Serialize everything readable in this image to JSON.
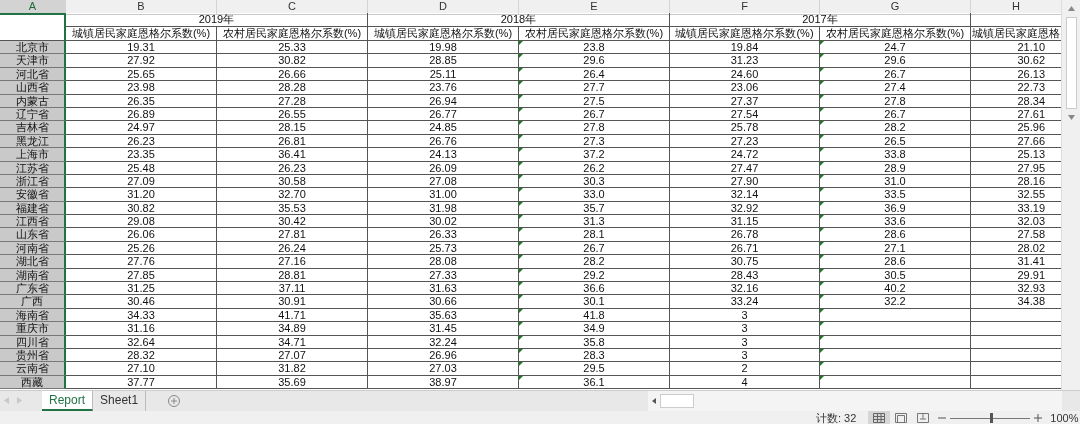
{
  "column_letters": [
    {
      "label": "A",
      "selected": true
    },
    {
      "label": "B",
      "selected": false
    },
    {
      "label": "C",
      "selected": false
    },
    {
      "label": "D",
      "selected": false
    },
    {
      "label": "E",
      "selected": false
    },
    {
      "label": "F",
      "selected": false
    },
    {
      "label": "G",
      "selected": false
    },
    {
      "label": "H",
      "selected": false
    }
  ],
  "year_groups": [
    {
      "label": "2019年"
    },
    {
      "label": "2018年"
    },
    {
      "label": "2017年"
    }
  ],
  "columns": [
    {
      "header": "城镇居民家庭恩格尔系数(%)",
      "flagged": false
    },
    {
      "header": "农村居民家庭恩格尔系数(%)",
      "flagged": false
    },
    {
      "header": "城镇居民家庭恩格尔系数(%)",
      "flagged": false
    },
    {
      "header": "农村居民家庭恩格尔系数(%)",
      "flagged": true
    },
    {
      "header": "城镇居民家庭恩格尔系数(%)",
      "flagged": false
    },
    {
      "header": "农村居民家庭恩格尔系数(%)",
      "flagged": true
    },
    {
      "header": "城镇居民家庭恩格",
      "flagged": false
    }
  ],
  "rows": [
    {
      "name": "北京市",
      "values": [
        "19.31",
        "25.33",
        "19.98",
        "23.8",
        "19.84",
        "24.7",
        "21.10"
      ]
    },
    {
      "name": "天津市",
      "values": [
        "27.92",
        "30.82",
        "28.85",
        "29.6",
        "31.23",
        "29.6",
        "30.62"
      ]
    },
    {
      "name": "河北省",
      "values": [
        "25.65",
        "26.66",
        "25.11",
        "26.4",
        "24.60",
        "26.7",
        "26.13"
      ]
    },
    {
      "name": "山西省",
      "values": [
        "23.98",
        "28.28",
        "23.76",
        "27.7",
        "23.06",
        "27.4",
        "22.73"
      ]
    },
    {
      "name": "内蒙古",
      "values": [
        "26.35",
        "27.28",
        "26.94",
        "27.5",
        "27.37",
        "27.8",
        "28.34"
      ]
    },
    {
      "name": "辽宁省",
      "values": [
        "26.89",
        "26.55",
        "26.77",
        "26.7",
        "27.54",
        "26.7",
        "27.61"
      ]
    },
    {
      "name": "吉林省",
      "values": [
        "24.97",
        "28.15",
        "24.85",
        "27.8",
        "25.78",
        "28.2",
        "25.96"
      ]
    },
    {
      "name": "黑龙江",
      "values": [
        "26.23",
        "26.81",
        "26.76",
        "27.3",
        "27.23",
        "26.5",
        "27.66"
      ]
    },
    {
      "name": "上海市",
      "values": [
        "23.35",
        "36.41",
        "24.13",
        "37.2",
        "24.72",
        "33.8",
        "25.13"
      ]
    },
    {
      "name": "江苏省",
      "values": [
        "25.48",
        "26.23",
        "26.09",
        "26.2",
        "27.47",
        "28.9",
        "27.95"
      ]
    },
    {
      "name": "浙江省",
      "values": [
        "27.09",
        "30.58",
        "27.08",
        "30.3",
        "27.90",
        "31.0",
        "28.16"
      ]
    },
    {
      "name": "安徽省",
      "values": [
        "31.20",
        "32.70",
        "31.00",
        "33.0",
        "32.14",
        "33.5",
        "32.55"
      ]
    },
    {
      "name": "福建省",
      "values": [
        "30.82",
        "35.53",
        "31.98",
        "35.7",
        "32.92",
        "36.9",
        "33.19"
      ]
    },
    {
      "name": "江西省",
      "values": [
        "29.08",
        "30.42",
        "30.02",
        "31.3",
        "31.15",
        "33.6",
        "32.03"
      ]
    },
    {
      "name": "山东省",
      "values": [
        "26.06",
        "27.81",
        "26.33",
        "28.1",
        "26.78",
        "28.6",
        "27.58"
      ]
    },
    {
      "name": "河南省",
      "values": [
        "25.26",
        "26.24",
        "25.73",
        "26.7",
        "26.71",
        "27.1",
        "28.02"
      ]
    },
    {
      "name": "湖北省",
      "values": [
        "27.76",
        "27.16",
        "28.08",
        "28.2",
        "30.75",
        "28.6",
        "31.41"
      ]
    },
    {
      "name": "湖南省",
      "values": [
        "27.85",
        "28.81",
        "27.33",
        "29.2",
        "28.43",
        "30.5",
        "29.91"
      ]
    },
    {
      "name": "广东省",
      "values": [
        "31.25",
        "37.11",
        "31.63",
        "36.6",
        "32.16",
        "40.2",
        "32.93"
      ]
    },
    {
      "name": "广西",
      "values": [
        "30.46",
        "30.91",
        "30.66",
        "30.1",
        "33.24",
        "32.2",
        "34.38"
      ]
    },
    {
      "name": "海南省",
      "values": [
        "34.33",
        "41.71",
        "35.63",
        "41.8",
        "3"
      ]
    },
    {
      "name": "重庆市",
      "values": [
        "31.16",
        "34.89",
        "31.45",
        "34.9",
        "3"
      ]
    },
    {
      "name": "四川省",
      "values": [
        "32.64",
        "34.71",
        "32.24",
        "35.8",
        "3"
      ]
    },
    {
      "name": "贵州省",
      "values": [
        "28.32",
        "27.07",
        "26.96",
        "28.3",
        "3"
      ]
    },
    {
      "name": "云南省",
      "values": [
        "27.10",
        "31.82",
        "27.03",
        "29.5",
        "2"
      ]
    },
    {
      "name": "西藏",
      "values": [
        "37.77",
        "35.69",
        "38.97",
        "36.1",
        "4"
      ]
    }
  ],
  "sheet_tabs": [
    {
      "label": "Report",
      "selected": true
    },
    {
      "label": "Sheet1",
      "selected": false
    }
  ],
  "status_bar": {
    "count": "计数: 32",
    "zoom": {
      "level": 0.5,
      "reading": "100%"
    }
  }
}
